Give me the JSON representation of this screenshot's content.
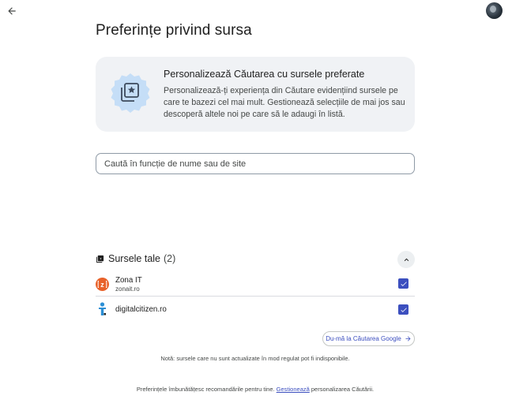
{
  "page": {
    "title": "Preferințe privind sursa"
  },
  "info_card": {
    "title": "Personalizează Căutarea cu sursele preferate",
    "text": "Personalizează-ți experiența din Căutare evidențiind sursele pe care te bazezi cel mai mult. Gestionează selecțiile de mai jos sau descoperă altele noi pe care să le adaugi în listă."
  },
  "search": {
    "placeholder": "Caută în funcție de nume sau de site"
  },
  "sources": {
    "title": "Sursele tale",
    "count": "(2)",
    "items": [
      {
        "name": "Zona IT",
        "url": "zonait.ro",
        "checked": true,
        "icon_color": "#e8622a"
      },
      {
        "name": "digitalcitizen.ro",
        "url": "",
        "checked": true,
        "icon_color": "#2d8fd5"
      }
    ]
  },
  "actions": {
    "goto_google": "Du-mă la Căutarea Google"
  },
  "note": "Notă: sursele care nu sunt actualizate în mod regulat pot fi indisponibile.",
  "footer": {
    "before": "Preferințele îmbunătățesc recomandările pentru tine.",
    "link": "Gestionează",
    "after": "personalizarea Căutării."
  },
  "colors": {
    "accent": "#3c4fbf",
    "card_bg": "#f0f2f5",
    "illustration": "#c5def7"
  },
  "icons": {
    "back": "arrow-left-icon",
    "sources": "library-icon",
    "collapse": "chevron-up-icon",
    "goto": "arrow-right-icon"
  }
}
